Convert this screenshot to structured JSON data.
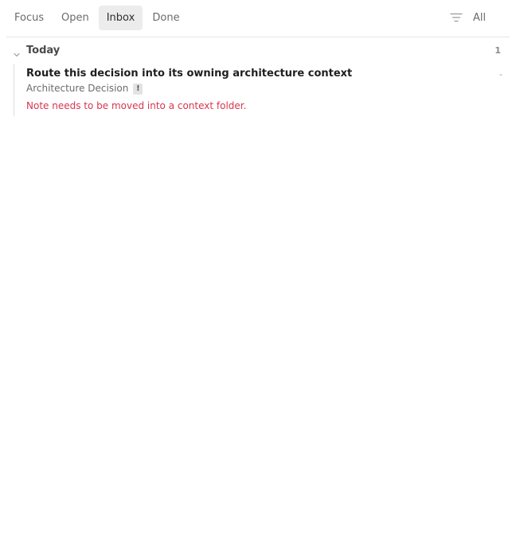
{
  "toolbar": {
    "tabs": [
      {
        "label": "Focus"
      },
      {
        "label": "Open"
      },
      {
        "label": "Inbox",
        "active": true
      },
      {
        "label": "Done"
      }
    ],
    "filter_icon": "filter-icon",
    "filter_label": "All"
  },
  "group": {
    "title": "Today",
    "count": "1",
    "expanded": true
  },
  "item": {
    "title": "Route this decision into its owning architecture context",
    "dash": "-",
    "type": "Architecture Decision",
    "badge": "!",
    "note": "Note needs to be moved into a context folder."
  },
  "colors": {
    "active_tab_bg": "#ececec",
    "note_text": "#d9354f"
  }
}
